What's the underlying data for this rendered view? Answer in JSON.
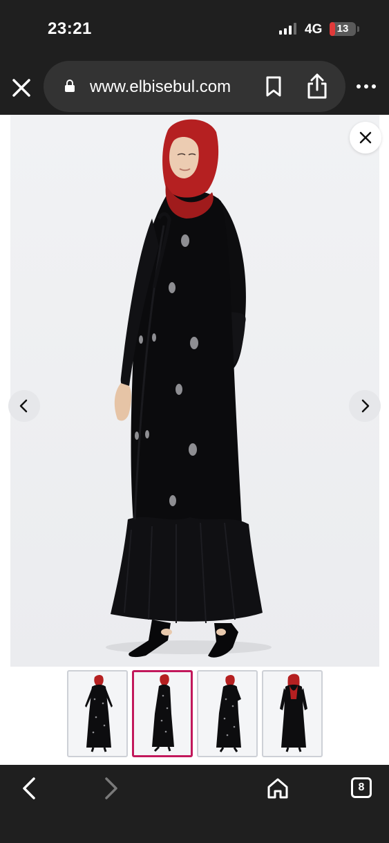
{
  "status_bar": {
    "time": "23:21",
    "network": "4G",
    "battery_level": "13",
    "battery_fraction": 0.13,
    "battery_color": "#e03a3a"
  },
  "browser": {
    "url": "www.elbisebul.com",
    "icons": {
      "close": "close-icon",
      "lock": "lock-icon",
      "bookmark": "bookmark-icon",
      "share": "share-icon",
      "more": "more-icon"
    }
  },
  "gallery": {
    "main_image": "product-photo-black-abaya-red-hijab",
    "thumbnails": [
      {
        "name": "front-view",
        "selected": false
      },
      {
        "name": "side-view",
        "selected": true
      },
      {
        "name": "three-quarter-view",
        "selected": false
      },
      {
        "name": "back-view",
        "selected": false
      }
    ],
    "accent_color": "#c2185b",
    "controls": [
      "close-icon",
      "chevron-left-icon",
      "chevron-right-icon"
    ]
  },
  "toolbar": {
    "tab_count": "8",
    "icons": [
      "back-icon",
      "forward-icon",
      "home-icon",
      "tabs-icon"
    ]
  }
}
